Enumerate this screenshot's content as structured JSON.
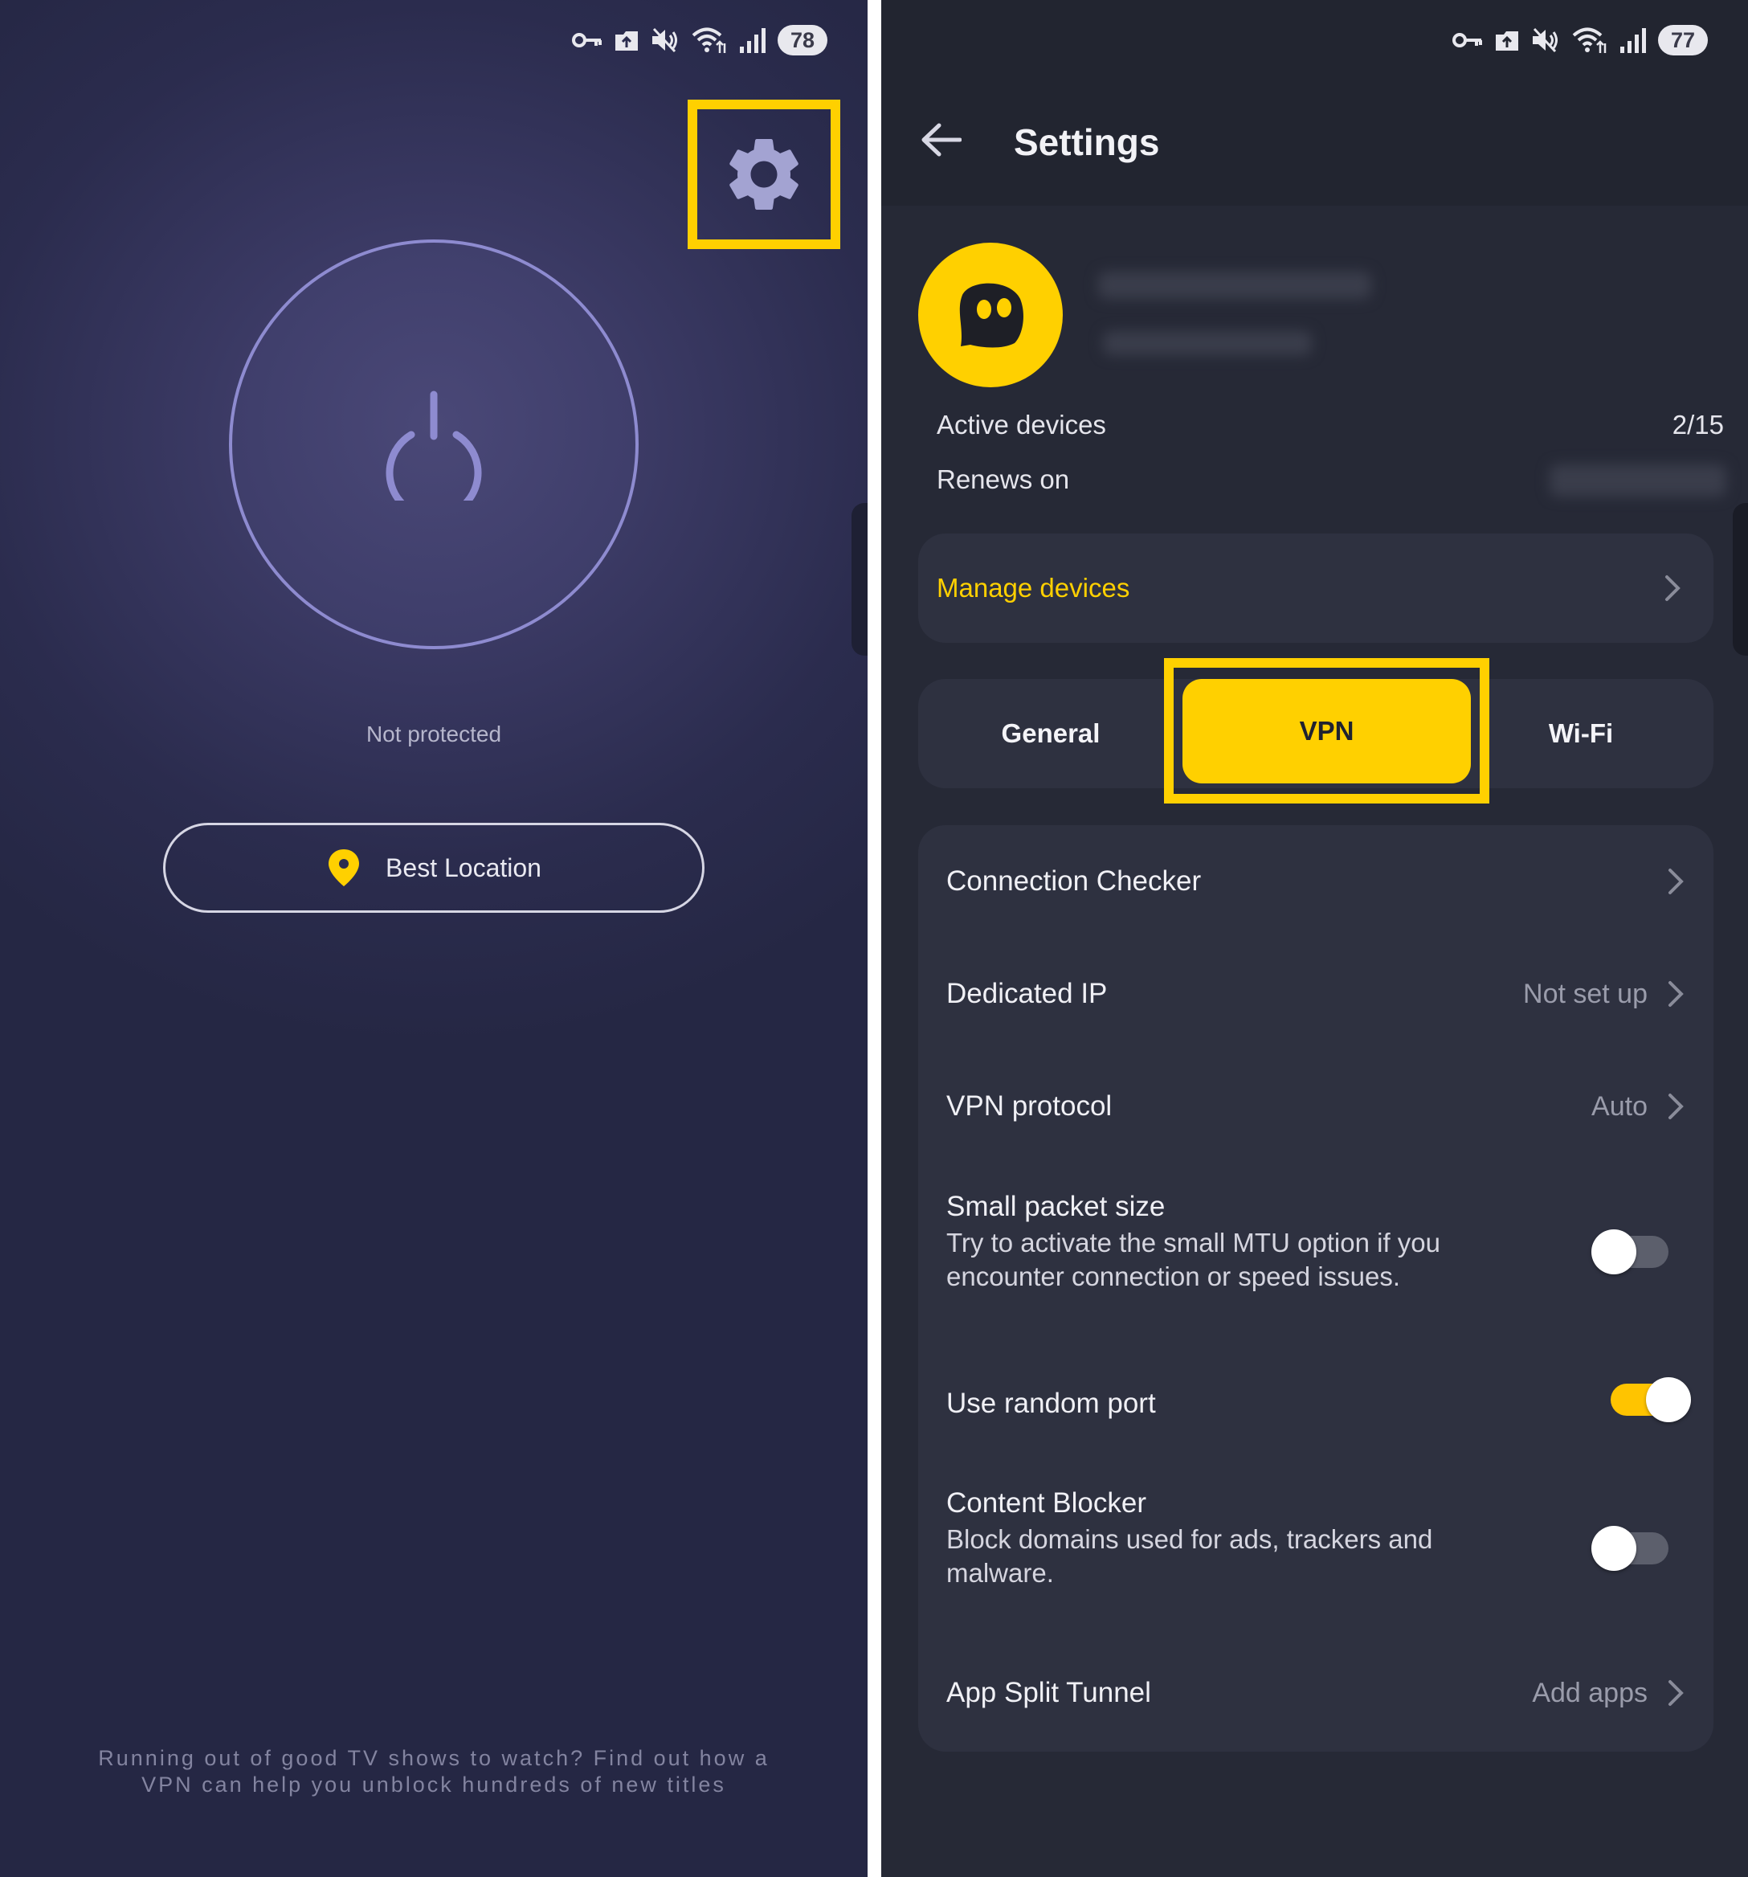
{
  "left_screen": {
    "status": {
      "battery": "78"
    },
    "status_text": "Not protected",
    "location_button": {
      "label": "Best Location"
    },
    "promo_text": "Running out of good TV shows to watch? Find out how a VPN can help you unblock hundreds of new titles"
  },
  "right_screen": {
    "status": {
      "battery": "77"
    },
    "title": "Settings",
    "account": {
      "active_devices_label": "Active devices",
      "active_devices_value": "2/15",
      "renews_label": "Renews on"
    },
    "manage_devices_label": "Manage devices",
    "tabs": [
      {
        "label": "General",
        "selected": false
      },
      {
        "label": "VPN",
        "selected": true
      },
      {
        "label": "Wi-Fi",
        "selected": false
      }
    ],
    "rows": {
      "connection_checker": {
        "label": "Connection Checker"
      },
      "dedicated_ip": {
        "label": "Dedicated IP",
        "value": "Not set up"
      },
      "vpn_protocol": {
        "label": "VPN protocol",
        "value": "Auto"
      },
      "small_packet": {
        "label": "Small packet size",
        "description": "Try to activate the small MTU option if you encounter connection or speed issues.",
        "enabled": false
      },
      "random_port": {
        "label": "Use random port",
        "enabled": true
      },
      "content_blocker": {
        "label": "Content Blocker",
        "description": "Block domains used for ads, trackers and malware.",
        "enabled": false
      },
      "split_tunnel": {
        "label": "App Split Tunnel",
        "value": "Add apps"
      }
    }
  },
  "colors": {
    "accent_yellow": "#ffd000",
    "left_bg": "#2b2c4e",
    "right_bg": "#262936",
    "card_bg": "#2e3140"
  },
  "icons": [
    "vpn-key-icon",
    "upload-icon",
    "mute-icon",
    "wifi-icon",
    "signal-icon",
    "gear-icon",
    "power-icon",
    "location-pin-icon",
    "back-arrow-icon",
    "ghost-logo-icon",
    "chevron-right-icon"
  ]
}
